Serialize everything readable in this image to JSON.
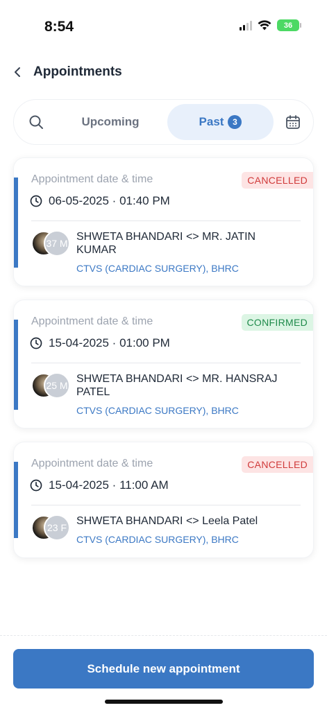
{
  "status_bar": {
    "time": "8:54",
    "battery": "36"
  },
  "header": {
    "title": "Appointments"
  },
  "tabs": {
    "upcoming": "Upcoming",
    "past": "Past",
    "past_count": "3"
  },
  "appointments": [
    {
      "label": "Appointment date & time",
      "status": "CANCELLED",
      "datetime": "06-05-2025 · 01:40 PM",
      "patient_initial": "37 M",
      "names": "SHWETA BHANDARI <> MR. JATIN KUMAR",
      "department": "CTVS (CARDIAC SURGERY), BHRC"
    },
    {
      "label": "Appointment date & time",
      "status": "CONFIRMED",
      "datetime": "15-04-2025 · 01:00 PM",
      "patient_initial": "25 M",
      "names": "SHWETA BHANDARI <> MR. HANSRAJ PATEL",
      "department": "CTVS (CARDIAC SURGERY), BHRC"
    },
    {
      "label": "Appointment date & time",
      "status": "CANCELLED",
      "datetime": "15-04-2025 · 11:00 AM",
      "patient_initial": "23 F",
      "names": "SHWETA BHANDARI <> Leela Patel",
      "department": "CTVS (CARDIAC SURGERY), BHRC"
    }
  ],
  "cta": {
    "label": "Schedule new appointment"
  },
  "colors": {
    "accent": "#3b78c4",
    "cancelled": "#d03a3a",
    "confirmed": "#1e8a4a"
  },
  "icons": {
    "back": "chevron-left-icon",
    "search": "search-icon",
    "calendar": "calendar-icon",
    "clock": "clock-icon"
  }
}
